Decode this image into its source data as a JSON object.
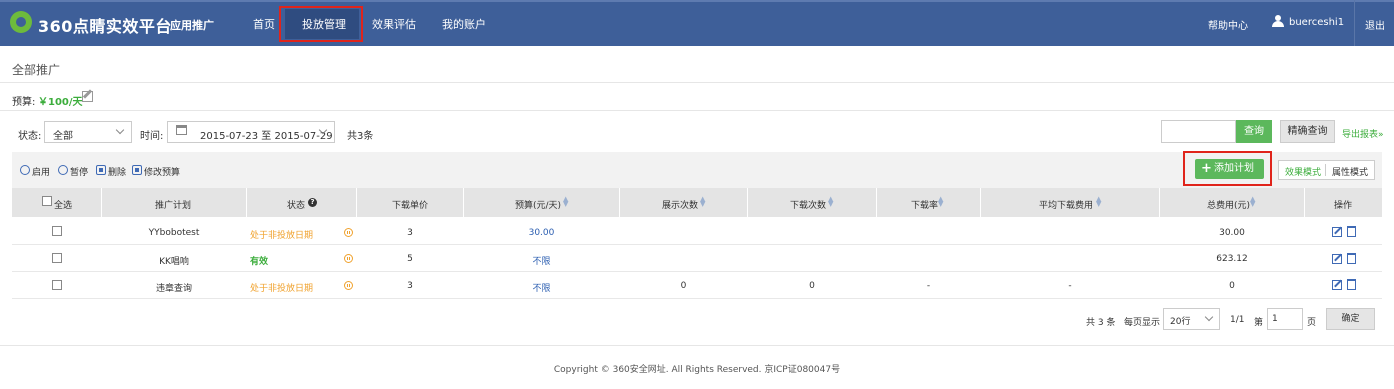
{
  "header": {
    "brand": "360点睛实效平台",
    "subbrand": "应用推广",
    "nav": [
      "首页",
      "投放管理",
      "效果评估",
      "我的账户"
    ],
    "active_nav": "投放管理",
    "help": "帮助中心",
    "username": "buerceshi1",
    "logout": "退出",
    "colors": {
      "header_bg": "#3e5f99",
      "accent": "#5cb85c",
      "highlight": "#e0241b"
    }
  },
  "page": {
    "title": "全部推广",
    "budget_label": "预算:",
    "budget_value": "￥100/天"
  },
  "filters": {
    "status_label": "状态:",
    "status_value": "全部",
    "time_label": "时间:",
    "date_range": "2015-07-23 至 2015-07-29",
    "count": "共3条",
    "query_button": "查询",
    "precise_query_button": "精确查询",
    "export_link": "导出报表»"
  },
  "toolbar": {
    "enable": "启用",
    "pause": "暂停",
    "delete": "删除",
    "edit_budget": "修改预算",
    "add_plan": "添加计划",
    "mode_effect": "效果模式",
    "mode_attr": "属性模式"
  },
  "table": {
    "headers": {
      "select_all": "全选",
      "plan": "推广计划",
      "status": "状态",
      "unit_price": "下载单价",
      "budget": "预算(元/天)",
      "impressions": "展示次数",
      "downloads": "下载次数",
      "download_rate": "下载率",
      "avg_cost": "平均下载费用",
      "total_cost": "总费用(元)",
      "actions": "操作"
    },
    "rows": [
      {
        "plan": "YYbobotest",
        "status": "处于非投放日期",
        "unit_price": "3",
        "budget": "30.00",
        "impressions": "",
        "downloads": "",
        "download_rate": "",
        "avg_cost": "",
        "total_cost": "30.00"
      },
      {
        "plan": "KK唱响",
        "status": "有效",
        "unit_price": "5",
        "budget": "不限",
        "impressions": "",
        "downloads": "",
        "download_rate": "",
        "avg_cost": "",
        "total_cost": "623.12"
      },
      {
        "plan": "违章查询",
        "status": "处于非投放日期",
        "unit_price": "3",
        "budget": "不限",
        "impressions": "0",
        "downloads": "0",
        "download_rate": "-",
        "avg_cost": "-",
        "total_cost": "0"
      }
    ]
  },
  "pagination": {
    "total": "共 3 条",
    "per_page_label": "每页显示",
    "per_page_value": "20行",
    "page_info": "1/1",
    "goto_prefix": "第",
    "goto_value": "1",
    "goto_suffix": "页",
    "confirm": "确定"
  },
  "footer": {
    "copyright": "Copyright © 360安全网址. All Rights Reserved. 京ICP证080047号"
  }
}
